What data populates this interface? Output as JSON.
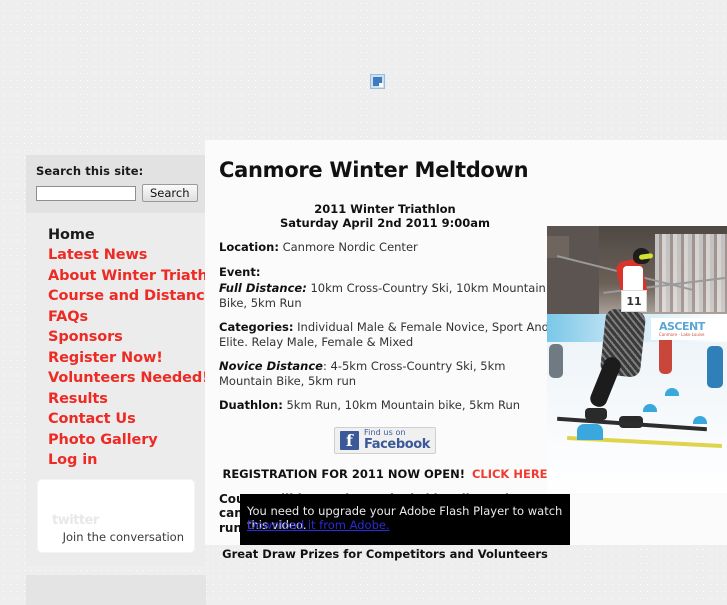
{
  "site": {
    "banner_icon": "broken-image-icon"
  },
  "sidebar": {
    "search": {
      "label": "Search this site:",
      "value": "",
      "placeholder": "",
      "button_label": "Search"
    },
    "nav_items": [
      {
        "label": "Home",
        "current": true
      },
      {
        "label": "Latest News",
        "current": false
      },
      {
        "label": "About Winter Triathlons",
        "current": false
      },
      {
        "label": "Course and Distances",
        "current": false
      },
      {
        "label": "FAQs",
        "current": false
      },
      {
        "label": "Sponsors",
        "current": false
      },
      {
        "label": "Register Now!",
        "current": false
      },
      {
        "label": "Volunteers Needed!",
        "current": false
      },
      {
        "label": "Results",
        "current": false
      },
      {
        "label": "Contact Us",
        "current": false
      },
      {
        "label": "Photo Gallery",
        "current": false
      },
      {
        "label": "Log in",
        "current": false
      }
    ],
    "twitter": {
      "logo_text": "twitter",
      "tagline": "Join the conversation"
    }
  },
  "main": {
    "title": "Canmore Winter Meltdown",
    "event_heading_line1": "2011 Winter Triathlon",
    "event_heading_line2": "Saturday April 2nd 2011 9:00am",
    "location_label": "Location:",
    "location_value": "Canmore Nordic Center",
    "event_label": "Event:",
    "full_distance_label": "Full Distance:",
    "full_distance_value": "10km Cross-Country Ski, 10km Mountain Bike, 5km Run",
    "categories_label": "Categories:",
    "categories_value": "Individual Male & Female Novice, Sport And Elite. Relay Male, Female & Mixed",
    "novice_label": "Novice Distance",
    "novice_value": ": 4-5km Cross-Country Ski, 5km Mountain Bike, 5km run",
    "duathlon_label": "Duathlon:",
    "duathlon_value": "5km Run, 10km Mountain bike, 5km Run",
    "facebook": {
      "small_text": "Find us on",
      "big_text": "Facebook",
      "icon": "facebook-f-icon"
    },
    "registration_text": "REGISTRATION FOR 2011 NOW OPEN!",
    "registration_link": "CLICK HERE",
    "course_note": "Course will be on the packed ski trails at the canmore nordic center. Expect to ski bike and run on snow!",
    "draw_prizes": "Great Draw Prizes for Competitors and Volunteers",
    "photo": {
      "bib_number": "11",
      "banner_text": "ASCENT",
      "banner_subtext": "Canmore - Lake Louise"
    },
    "flash": {
      "message": "You need to upgrade your Adobe Flash Player to watch this video.",
      "link_text": "Download it from Adobe."
    }
  },
  "colors": {
    "link_red": "#ee2a24",
    "facebook_blue": "#3b5998",
    "flash_link_blue": "#2b2bd8"
  }
}
